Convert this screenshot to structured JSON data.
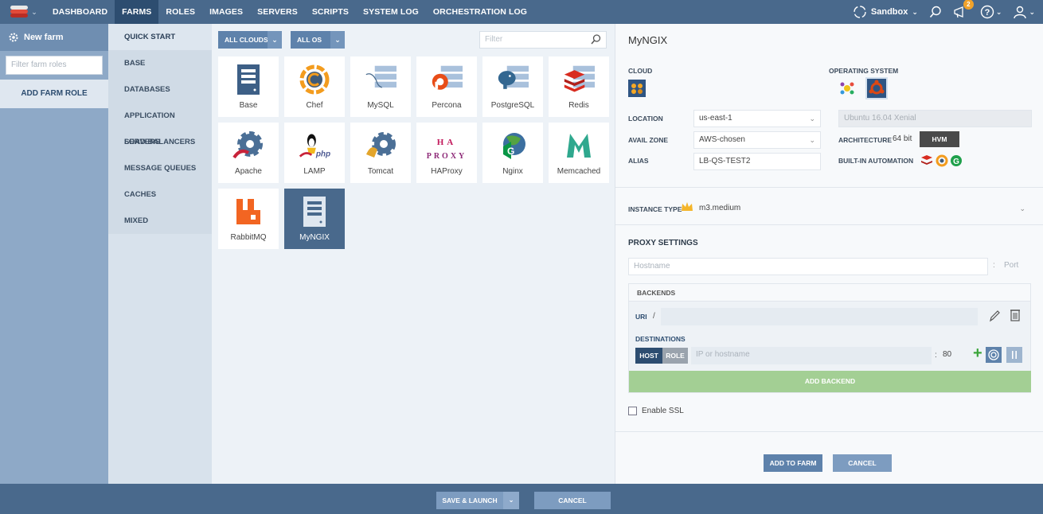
{
  "nav": {
    "items": [
      "DASHBOARD",
      "FARMS",
      "ROLES",
      "IMAGES",
      "SERVERS",
      "SCRIPTS",
      "SYSTEM LOG",
      "ORCHESTRATION LOG"
    ],
    "active": "FARMS",
    "environment": "Sandbox",
    "notifications_count": "2"
  },
  "sidebar": {
    "new_farm": "New farm",
    "filter_placeholder": "Filter farm roles",
    "add_farm_role": "ADD FARM ROLE"
  },
  "categories": [
    "QUICK START",
    "BASE",
    "DATABASES",
    "APPLICATION SERVERS",
    "LOAD BALANCERS",
    "MESSAGE QUEUES",
    "CACHES",
    "MIXED"
  ],
  "grid": {
    "clouds_label": "ALL CLOUDS",
    "os_label": "ALL OS",
    "filter_placeholder": "Filter",
    "roles": [
      {
        "label": "Base",
        "icon": "server-icon"
      },
      {
        "label": "Chef",
        "icon": "chef-icon"
      },
      {
        "label": "MySQL",
        "icon": "mysql-icon"
      },
      {
        "label": "Percona",
        "icon": "percona-icon"
      },
      {
        "label": "PostgreSQL",
        "icon": "postgresql-icon"
      },
      {
        "label": "Redis",
        "icon": "redis-icon"
      },
      {
        "label": "Apache",
        "icon": "apache-icon"
      },
      {
        "label": "LAMP",
        "icon": "lamp-icon"
      },
      {
        "label": "Tomcat",
        "icon": "tomcat-icon"
      },
      {
        "label": "HAProxy",
        "icon": "haproxy-icon"
      },
      {
        "label": "Nginx",
        "icon": "nginx-icon"
      },
      {
        "label": "Memcached",
        "icon": "memcached-icon"
      },
      {
        "label": "RabbitMQ",
        "icon": "rabbitmq-icon"
      },
      {
        "label": "MyNGIX",
        "icon": "server-icon"
      }
    ],
    "haproxy_text": "HA PROXY",
    "selected": "MyNGIX"
  },
  "detail": {
    "title": "MyNGIX",
    "cloud_label": "CLOUD",
    "os_label": "OPERATING SYSTEM",
    "location_label": "LOCATION",
    "location_value": "us-east-1",
    "os_value": "Ubuntu 16.04 Xenial",
    "avail_zone_label": "AVAIL ZONE",
    "avail_zone_value": "AWS-chosen",
    "architecture_label": "ARCHITECTURE",
    "architecture_value": "64 bit",
    "virtualization": "HVM",
    "alias_label": "ALIAS",
    "alias_value": "LB-QS-TEST2",
    "automation_label": "BUILT-IN AUTOMATION",
    "instance_type_label": "INSTANCE TYPE",
    "instance_type_value": "m3.medium",
    "proxy_settings": "PROXY SETTINGS",
    "hostname_placeholder": "Hostname",
    "port_placeholder": "Port",
    "backends_label": "BACKENDS",
    "uri_label": "URI",
    "uri_prefix": "/",
    "destinations_label": "DESTINATIONS",
    "host_tab": "HOST",
    "role_tab": "ROLE",
    "ip_placeholder": "IP or hostname",
    "dest_port": "80",
    "add_backend": "ADD BACKEND",
    "enable_ssl": "Enable SSL",
    "add_to_farm": "ADD TO FARM",
    "cancel": "CANCEL"
  },
  "footer": {
    "save_launch": "SAVE & LAUNCH",
    "cancel": "CANCEL"
  },
  "colors": {
    "topbar": "#49698c",
    "accent": "#5e82ab",
    "add_backend": "#a3cf94",
    "hvm": "#4a4a4a"
  }
}
